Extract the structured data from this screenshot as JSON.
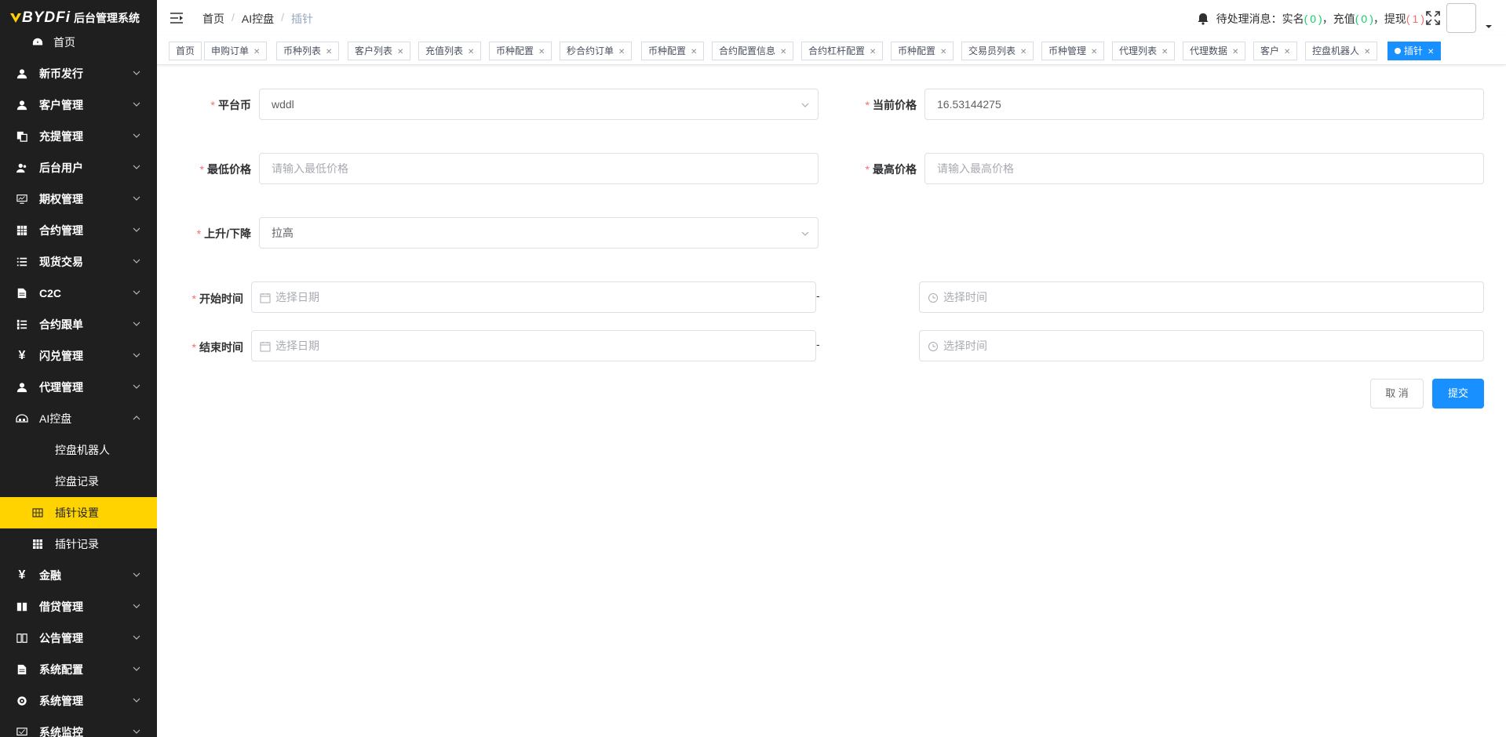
{
  "brand": {
    "logo_text": "BYDFi",
    "app_name": "后台管理系统"
  },
  "sidebar": {
    "items": [
      {
        "label": "首页",
        "icon": "dashboard-icon"
      },
      {
        "label": "新币发行",
        "icon": "user-icon"
      },
      {
        "label": "客户管理",
        "icon": "user-icon"
      },
      {
        "label": "充提管理",
        "icon": "copy-icon"
      },
      {
        "label": "后台用户",
        "icon": "users-icon"
      },
      {
        "label": "期权管理",
        "icon": "monitor-icon"
      },
      {
        "label": "合约管理",
        "icon": "grid-icon"
      },
      {
        "label": "现货交易",
        "icon": "list-icon"
      },
      {
        "label": "C2C",
        "icon": "document-icon"
      },
      {
        "label": "合约跟单",
        "icon": "list-check-icon"
      },
      {
        "label": "闪兑管理",
        "icon": "yen-icon"
      },
      {
        "label": "代理管理",
        "icon": "user-icon"
      },
      {
        "label": "AI控盘",
        "icon": "robot-icon"
      },
      {
        "label": "金融",
        "icon": "yen-icon"
      },
      {
        "label": "借贷管理",
        "icon": "book-icon"
      },
      {
        "label": "公告管理",
        "icon": "open-book-icon"
      },
      {
        "label": "系统配置",
        "icon": "document-icon"
      },
      {
        "label": "系统管理",
        "icon": "gear-icon"
      },
      {
        "label": "系统监控",
        "icon": "monitor-check-icon"
      }
    ],
    "sub_items": [
      {
        "label": "控盘机器人"
      },
      {
        "label": "控盘记录"
      },
      {
        "label": "插针设置"
      },
      {
        "label": "插针记录"
      }
    ]
  },
  "header": {
    "breadcrumb": [
      "首页",
      "AI控盘",
      "插针"
    ],
    "notice_prefix": "待处理消息：实名",
    "realname_count": "0",
    "recharge_label": "，充值",
    "recharge_count": "0",
    "withdraw_label": "，提现",
    "withdraw_count": "1",
    "colors": {
      "green": "#13ce66",
      "red": "#f56c6c"
    }
  },
  "tags": [
    {
      "label": "首页"
    },
    {
      "label": "申购订单"
    },
    {
      "label": "币种列表"
    },
    {
      "label": "客户列表"
    },
    {
      "label": "充值列表"
    },
    {
      "label": "币种配置"
    },
    {
      "label": "秒合约订单"
    },
    {
      "label": "币种配置"
    },
    {
      "label": "合约配置信息"
    },
    {
      "label": "合约杠杆配置"
    },
    {
      "label": "币种配置"
    },
    {
      "label": "交易员列表"
    },
    {
      "label": "币种管理"
    },
    {
      "label": "代理列表"
    },
    {
      "label": "代理数据"
    },
    {
      "label": "客户"
    },
    {
      "label": "控盘机器人"
    },
    {
      "label": "插针",
      "active": true
    }
  ],
  "form": {
    "platform_coin": {
      "label": "平台币",
      "value": "wddl"
    },
    "current_price": {
      "label": "当前价格",
      "value": "16.53144275"
    },
    "min_price": {
      "label": "最低价格",
      "placeholder": "请输入最低价格"
    },
    "max_price": {
      "label": "最高价格",
      "placeholder": "请输入最高价格"
    },
    "direction": {
      "label": "上升/下降",
      "value": "拉高"
    },
    "start_time": {
      "label": "开始时间",
      "date_placeholder": "选择日期",
      "time_placeholder": "选择时间"
    },
    "end_time": {
      "label": "结束时间",
      "date_placeholder": "选择日期",
      "time_placeholder": "选择时间"
    },
    "dash": "-",
    "cancel_label": "取 消",
    "submit_label": "提交"
  },
  "colors": {
    "sidebar_bg": "#1f1f1f",
    "active_menu": "#ffd300",
    "primary": "#1890ff"
  }
}
